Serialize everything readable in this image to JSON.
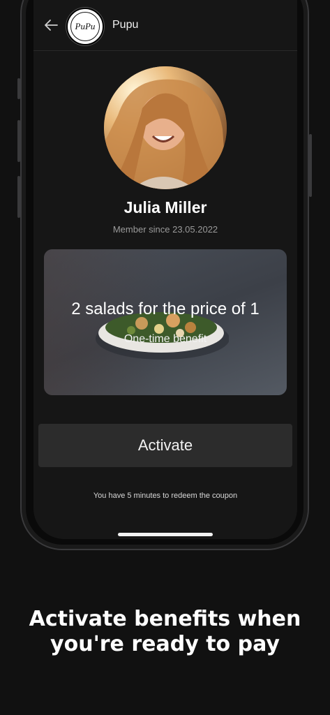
{
  "header": {
    "back_icon": "arrow-left-icon",
    "logo_text": "PuPu",
    "brand_name": "Pupu"
  },
  "profile": {
    "name": "Julia Miller",
    "member_since": "Member since 23.05.2022",
    "avatar": "woman-portrait-photo"
  },
  "benefit": {
    "title": "2 salads for the price of 1",
    "subtitle": "One-time benefit",
    "image": "salad-bowl-photo"
  },
  "actions": {
    "activate_label": "Activate"
  },
  "notice": {
    "redeem_text": "You have 5 minutes to redeem the coupon"
  },
  "promo": {
    "line1": "Activate benefits when",
    "line2": "you're ready to pay"
  },
  "colors": {
    "background": "#111111",
    "screen": "#161616",
    "button": "#2c2c2c",
    "text": "#ffffff"
  }
}
